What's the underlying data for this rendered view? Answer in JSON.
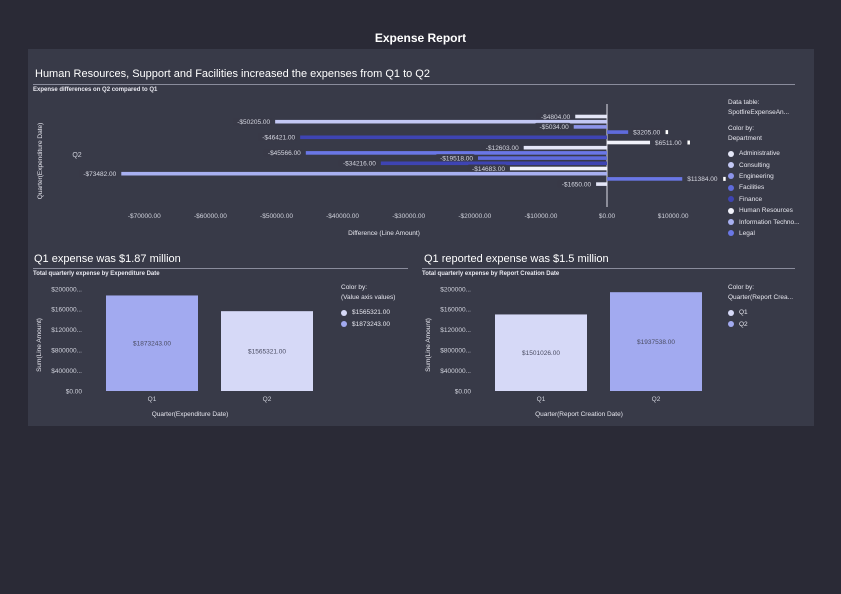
{
  "report_title": "Expense Report",
  "top": {
    "heading": "Human Resources, Support and Facilities increased the expenses from Q1 to Q2",
    "subtitle": "Expense differences on Q2 compared to Q1",
    "legend": {
      "data_table_label": "Data table:",
      "data_table_value": "SpotfireExpenseAn...",
      "color_by_label": "Color by:",
      "color_by_value": "Department",
      "items": [
        {
          "label": "Administrative",
          "color": "#e4e6f7"
        },
        {
          "label": "Consulting",
          "color": "#c3c8f4"
        },
        {
          "label": "Engineering",
          "color": "#8c94ea"
        },
        {
          "label": "Facilities",
          "color": "#5f6bdc"
        },
        {
          "label": "Finance",
          "color": "#3e44b3"
        },
        {
          "label": "Human Resources",
          "color": "#f1f2fb"
        },
        {
          "label": "Information Techno...",
          "color": "#a8b0f1"
        },
        {
          "label": "Legal",
          "color": "#6a77e6"
        }
      ]
    }
  },
  "bottom_left": {
    "heading": "Q1 expense was $1.87 million",
    "subtitle": "Total quarterly expense by Expenditure Date",
    "legend": {
      "color_by_label": "Color by:",
      "color_by_value": "(Value axis values)",
      "items": [
        {
          "label": "$1565321.00",
          "color": "#d6d9f7"
        },
        {
          "label": "$1873243.00",
          "color": "#a2aaf0"
        }
      ]
    }
  },
  "bottom_right": {
    "heading": "Q1 reported expense was $1.5 million",
    "subtitle": "Total quarterly expense by Report Creation Date",
    "legend": {
      "color_by_label": "Color by:",
      "color_by_value": "Quarter(Report Crea...",
      "items": [
        {
          "label": "Q1",
          "color": "#d6d9f7"
        },
        {
          "label": "Q2",
          "color": "#a2aaf0"
        }
      ]
    }
  },
  "chart_data": [
    {
      "type": "bar",
      "orientation": "horizontal",
      "xlabel": "Difference (Line Amount)",
      "ylabel": "Quarter(Expenditure Date)",
      "categories": [
        "Q2"
      ],
      "xlim": [
        -80000,
        15000
      ],
      "x_ticks": [
        -70000,
        -60000,
        -50000,
        -40000,
        -30000,
        -20000,
        -10000,
        0,
        10000
      ],
      "x_tick_labels": [
        "-$70000.00",
        "-$60000.00",
        "-$50000.00",
        "-$40000.00",
        "-$30000.00",
        "-$20000.00",
        "-$10000.00",
        "$0.00",
        "$10000.00"
      ],
      "bars": [
        {
          "value": -4804,
          "label": "-$4804.00",
          "color": "#e4e6f7"
        },
        {
          "value": -50205,
          "label": "-$50205.00",
          "color": "#c3c8f4"
        },
        {
          "value": -5034,
          "label": "-$5034.00",
          "color": "#8c94ea"
        },
        {
          "value": 3205,
          "label": "$3205.00",
          "color": "#5f6bdc"
        },
        {
          "value": -46421,
          "label": "-$46421.00",
          "color": "#3e44b3"
        },
        {
          "value": 6511,
          "label": "$6511.00",
          "color": "#f1f2fb"
        },
        {
          "value": -12603,
          "label": "-$12603.00",
          "color": "#e4e6f7"
        },
        {
          "value": -45566,
          "label": "-$45566.00",
          "color": "#6a77e6"
        },
        {
          "value": -19518,
          "label": "-$19518.00",
          "color": "#5f6bdc"
        },
        {
          "value": -34216,
          "label": "-$34216.00",
          "color": "#3e44b3"
        },
        {
          "value": -14683,
          "label": "-$14683.00",
          "color": "#f1f2fb"
        },
        {
          "value": -73482,
          "label": "-$73482.00",
          "color": "#a8b0f1"
        },
        {
          "value": 11384,
          "label": "$11384.00",
          "color": "#6a77e6"
        },
        {
          "value": -1650,
          "label": "-$1650.00",
          "color": "#e4e6f7"
        }
      ],
      "grid": false
    },
    {
      "type": "bar",
      "xlabel": "Quarter(Expenditure Date)",
      "ylabel": "Sum(Line Amount)",
      "categories": [
        "Q1",
        "Q2"
      ],
      "values": [
        1873243,
        1565321
      ],
      "value_labels": [
        "$1873243.00",
        "$1565321.00"
      ],
      "colors": [
        "#a2aaf0",
        "#d6d9f7"
      ],
      "ylim": [
        0,
        2000000
      ],
      "y_ticks": [
        0,
        400000,
        800000,
        1200000,
        1600000,
        2000000
      ],
      "y_tick_labels": [
        "$0.00",
        "$400000...",
        "$800000...",
        "$120000...",
        "$160000...",
        "$200000..."
      ],
      "grid": false
    },
    {
      "type": "bar",
      "xlabel": "Quarter(Report Creation Date)",
      "ylabel": "Sum(Line Amount)",
      "categories": [
        "Q1",
        "Q2"
      ],
      "values": [
        1501026,
        1937538
      ],
      "value_labels": [
        "$1501026.00",
        "$1937538.00"
      ],
      "colors": [
        "#d6d9f7",
        "#a2aaf0"
      ],
      "ylim": [
        0,
        2000000
      ],
      "y_ticks": [
        0,
        400000,
        800000,
        1200000,
        1600000,
        2000000
      ],
      "y_tick_labels": [
        "$0.00",
        "$400000...",
        "$800000...",
        "$120000...",
        "$160000...",
        "$200000..."
      ],
      "grid": false
    }
  ]
}
